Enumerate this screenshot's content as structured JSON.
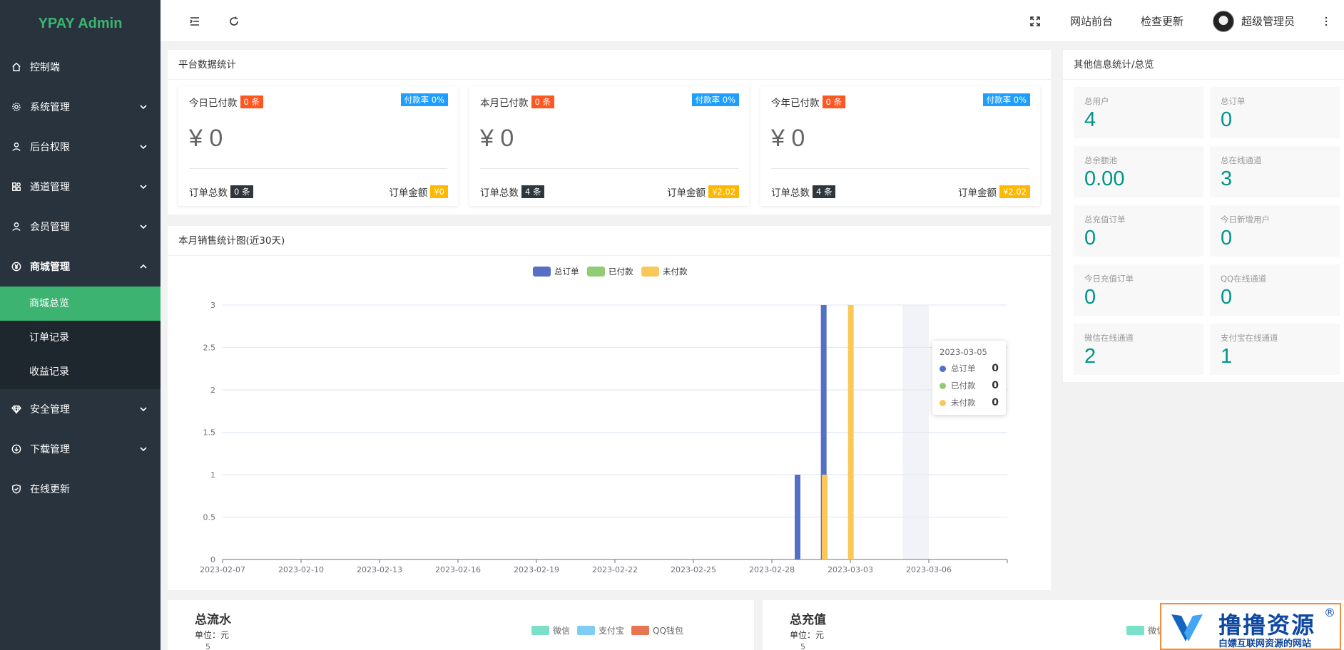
{
  "brand": "YPAY Admin",
  "sidebar": {
    "items": [
      {
        "label": "控制端",
        "icon": "home-icon"
      },
      {
        "label": "系统管理",
        "icon": "gear-icon"
      },
      {
        "label": "后台权限",
        "icon": "user-icon"
      },
      {
        "label": "通道管理",
        "icon": "apps-icon"
      },
      {
        "label": "会员管理",
        "icon": "user-icon"
      },
      {
        "label": "商城管理",
        "icon": "yen-icon"
      },
      {
        "label": "安全管理",
        "icon": "diamond-icon"
      },
      {
        "label": "下载管理",
        "icon": "download-icon"
      },
      {
        "label": "在线更新",
        "icon": "shield-check-icon"
      }
    ],
    "submenu": [
      {
        "label": "商城总览",
        "active": true
      },
      {
        "label": "订单记录",
        "active": false
      },
      {
        "label": "收益记录",
        "active": false
      }
    ]
  },
  "header": {
    "front_link": "网站前台",
    "check_update": "检查更新",
    "username": "超级管理员"
  },
  "platform": {
    "title": "平台数据统计",
    "cards": [
      {
        "label": "今日已付款",
        "count_badge": "0 条",
        "rate_badge": "付款率 0%",
        "amount": "¥ 0",
        "orders_label": "订单总数",
        "orders_badge": "0 条",
        "amount_label": "订单金额",
        "amount_badge": "¥0"
      },
      {
        "label": "本月已付款",
        "count_badge": "0 条",
        "rate_badge": "付款率 0%",
        "amount": "¥ 0",
        "orders_label": "订单总数",
        "orders_badge": "4 条",
        "amount_label": "订单金额",
        "amount_badge": "¥2.02"
      },
      {
        "label": "今年已付款",
        "count_badge": "0 条",
        "rate_badge": "付款率 0%",
        "amount": "¥ 0",
        "orders_label": "订单总数",
        "orders_badge": "4 条",
        "amount_label": "订单金额",
        "amount_badge": "¥2.02"
      }
    ]
  },
  "other": {
    "title": "其他信息统计/总览",
    "items": [
      {
        "label": "总用户",
        "value": "4"
      },
      {
        "label": "总订单",
        "value": "0"
      },
      {
        "label": "总余额池",
        "value": "0.00"
      },
      {
        "label": "总在线通道",
        "value": "3"
      },
      {
        "label": "总充值订单",
        "value": "0"
      },
      {
        "label": "今日新增用户",
        "value": "0"
      },
      {
        "label": "今日充值订单",
        "value": "0"
      },
      {
        "label": "QQ在线通道",
        "value": "0"
      },
      {
        "label": "微信在线通道",
        "value": "2"
      },
      {
        "label": "支付宝在线通道",
        "value": "1"
      }
    ]
  },
  "sales_chart": {
    "title": "本月销售统计图(近30天)",
    "tooltip": {
      "date": "2023-03-05",
      "rows": [
        {
          "name": "总订单",
          "value": "0"
        },
        {
          "name": "已付款",
          "value": "0"
        },
        {
          "name": "未付款",
          "value": "0"
        }
      ]
    }
  },
  "chart_data": {
    "type": "bar",
    "categories": [
      "2023-02-07",
      "2023-02-08",
      "2023-02-09",
      "2023-02-10",
      "2023-02-11",
      "2023-02-12",
      "2023-02-13",
      "2023-02-14",
      "2023-02-15",
      "2023-02-16",
      "2023-02-17",
      "2023-02-18",
      "2023-02-19",
      "2023-02-20",
      "2023-02-21",
      "2023-02-22",
      "2023-02-23",
      "2023-02-24",
      "2023-02-25",
      "2023-02-26",
      "2023-02-27",
      "2023-02-28",
      "2023-03-01",
      "2023-03-02",
      "2023-03-03",
      "2023-03-04",
      "2023-03-05",
      "2023-03-06",
      "2023-03-07",
      "2023-03-08"
    ],
    "tick_labels": [
      "2023-02-07",
      "2023-02-10",
      "2023-02-13",
      "2023-02-16",
      "2023-02-19",
      "2023-02-22",
      "2023-02-25",
      "2023-02-28",
      "2023-03-03",
      "2023-03-06"
    ],
    "series": [
      {
        "name": "总订单",
        "color": "#5470c6",
        "values": [
          0,
          0,
          0,
          0,
          0,
          0,
          0,
          0,
          0,
          0,
          0,
          0,
          0,
          0,
          0,
          0,
          0,
          0,
          0,
          0,
          0,
          0,
          1,
          3,
          0,
          0,
          0,
          0,
          0,
          0
        ]
      },
      {
        "name": "已付款",
        "color": "#91cc75",
        "values": [
          0,
          0,
          0,
          0,
          0,
          0,
          0,
          0,
          0,
          0,
          0,
          0,
          0,
          0,
          0,
          0,
          0,
          0,
          0,
          0,
          0,
          0,
          0,
          0,
          0,
          0,
          0,
          0,
          0,
          0
        ]
      },
      {
        "name": "未付款",
        "color": "#fac858",
        "values": [
          0,
          0,
          0,
          0,
          0,
          0,
          0,
          0,
          0,
          0,
          0,
          0,
          0,
          0,
          0,
          0,
          0,
          0,
          0,
          0,
          0,
          0,
          1,
          3,
          0,
          0,
          0,
          0,
          0,
          0
        ]
      }
    ],
    "yticks": [
      "0",
      "0.5",
      "1",
      "1.5",
      "2",
      "2.5",
      "3"
    ],
    "ylim": [
      0,
      3
    ],
    "highlight_category": "2023-03-05",
    "legend": "top-center",
    "grid": true
  },
  "bottom": {
    "left": {
      "title": "总流水",
      "unit": "单位：元",
      "tick": "5",
      "legend": [
        {
          "name": "微信",
          "color": "#7be0c8"
        },
        {
          "name": "支付宝",
          "color": "#7fcdf5"
        },
        {
          "name": "QQ钱包",
          "color": "#e8754f"
        }
      ]
    },
    "right": {
      "title": "总充值",
      "unit": "单位：元",
      "tick": "5",
      "legend": [
        {
          "name": "微信",
          "color": "#7be0c8"
        }
      ]
    }
  },
  "watermark": {
    "text": "撸撸资源",
    "sub": "白嫖互联网资源的网站",
    "mark": "®"
  }
}
